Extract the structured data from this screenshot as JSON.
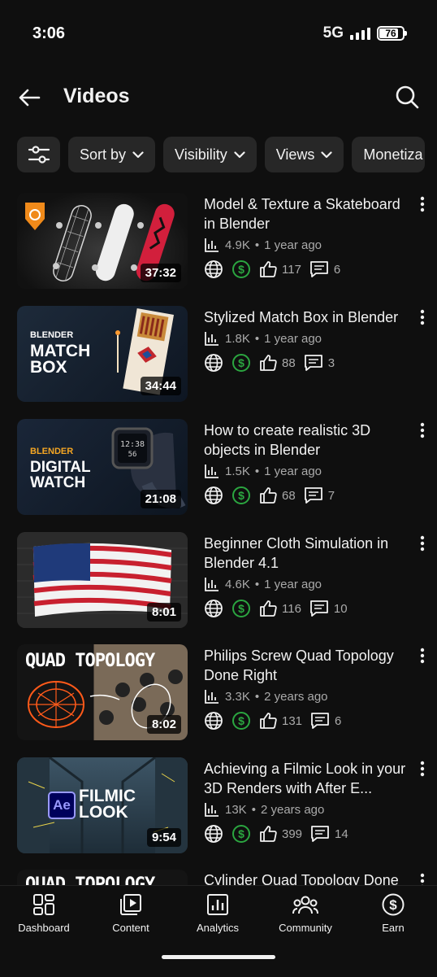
{
  "status": {
    "time": "3:06",
    "network": "5G",
    "battery": "76",
    "battery_level": 0.76
  },
  "appbar": {
    "title": "Videos",
    "back_icon": "arrow-left-icon",
    "search_icon": "search-icon"
  },
  "chips": {
    "sort": "Sort by",
    "visibility": "Visibility",
    "views": "Views",
    "monetization": "Monetiza"
  },
  "videos": [
    {
      "title": "Model & Texture a Skateboard in Blender",
      "duration": "37:32",
      "views": "4.9K",
      "age": "1 year ago",
      "likes": "117",
      "comments": "6"
    },
    {
      "title": "Stylized Match Box in Blender",
      "duration": "34:44",
      "views": "1.8K",
      "age": "1 year ago",
      "likes": "88",
      "comments": "3",
      "thumb_brand": "BLENDER",
      "thumb_line1": "MATCH",
      "thumb_line2": "BOX"
    },
    {
      "title": "How to create realistic 3D objects in Blender",
      "duration": "21:08",
      "views": "1.5K",
      "age": "1 year ago",
      "likes": "68",
      "comments": "7",
      "thumb_brand": "BLENDER",
      "thumb_line1": "DIGITAL",
      "thumb_line2": "WATCH"
    },
    {
      "title": "Beginner Cloth Simulation in Blender 4.1",
      "duration": "8:01",
      "views": "4.6K",
      "age": "1 year ago",
      "likes": "116",
      "comments": "10"
    },
    {
      "title": "Philips Screw Quad Topology Done Right",
      "duration": "8:02",
      "views": "3.3K",
      "age": "2 years ago",
      "likes": "131",
      "comments": "6",
      "thumb_line1": "QUAD TOPOLOGY"
    },
    {
      "title": "Achieving a Filmic Look in your 3D Renders with After E...",
      "duration": "9:54",
      "views": "13K",
      "age": "2 years ago",
      "likes": "399",
      "comments": "14",
      "thumb_badge": "Ae",
      "thumb_line1": "FILMIC",
      "thumb_line2": "LOOK"
    },
    {
      "title": "Cylinder Quad Topology Done",
      "thumb_line1": "QUAD TOPOLOGY"
    }
  ],
  "nav": [
    {
      "label": "Dashboard",
      "icon": "dashboard-icon"
    },
    {
      "label": "Content",
      "icon": "content-icon"
    },
    {
      "label": "Analytics",
      "icon": "analytics-icon"
    },
    {
      "label": "Community",
      "icon": "community-icon"
    },
    {
      "label": "Earn",
      "icon": "earn-icon"
    }
  ],
  "colors": {
    "background": "#0f0f0f",
    "chip": "#272727",
    "monetized": "#2ba640",
    "meta": "#aaaaaa"
  }
}
